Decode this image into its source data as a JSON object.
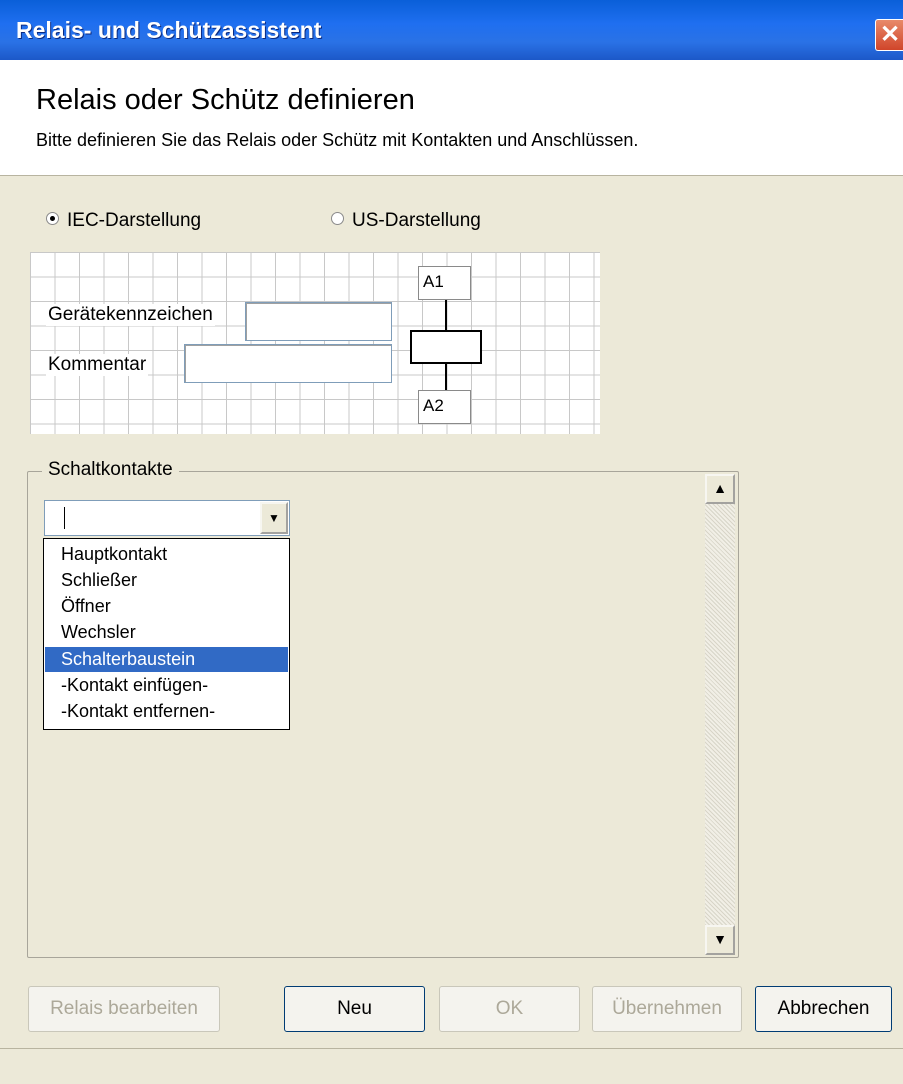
{
  "window": {
    "title": "Relais- und Schützassistent",
    "close_glyph": "✕"
  },
  "header": {
    "heading": "Relais oder Schütz definieren",
    "subtitle": "Bitte definieren Sie das Relais oder Schütz mit Kontakten und Anschlüssen."
  },
  "representation": {
    "options": [
      {
        "label": "IEC-Darstellung",
        "selected": true
      },
      {
        "label": "US-Darstellung",
        "selected": false
      }
    ]
  },
  "form": {
    "device_id_label": "Gerätekennzeichen",
    "device_id_value": "",
    "comment_label": "Kommentar",
    "comment_value": ""
  },
  "coil": {
    "top_terminal": "A1",
    "bottom_terminal": "A2"
  },
  "contacts": {
    "group_label": "Schaltkontakte",
    "combo_value": "",
    "options": [
      "Hauptkontakt",
      "Schließer",
      "Öffner",
      "Wechsler",
      "Schalterbaustein",
      "-Kontakt einfügen-",
      "-Kontakt entfernen-"
    ],
    "highlighted": "Schalterbaustein"
  },
  "buttons": {
    "edit_relay": "Relais bearbeiten",
    "new": "Neu",
    "ok": "OK",
    "apply": "Übernehmen",
    "cancel": "Abbrechen"
  },
  "colors": {
    "titlebar": "#2a72e6",
    "selection": "#316ac5",
    "dialog_bg": "#ece9d8"
  }
}
